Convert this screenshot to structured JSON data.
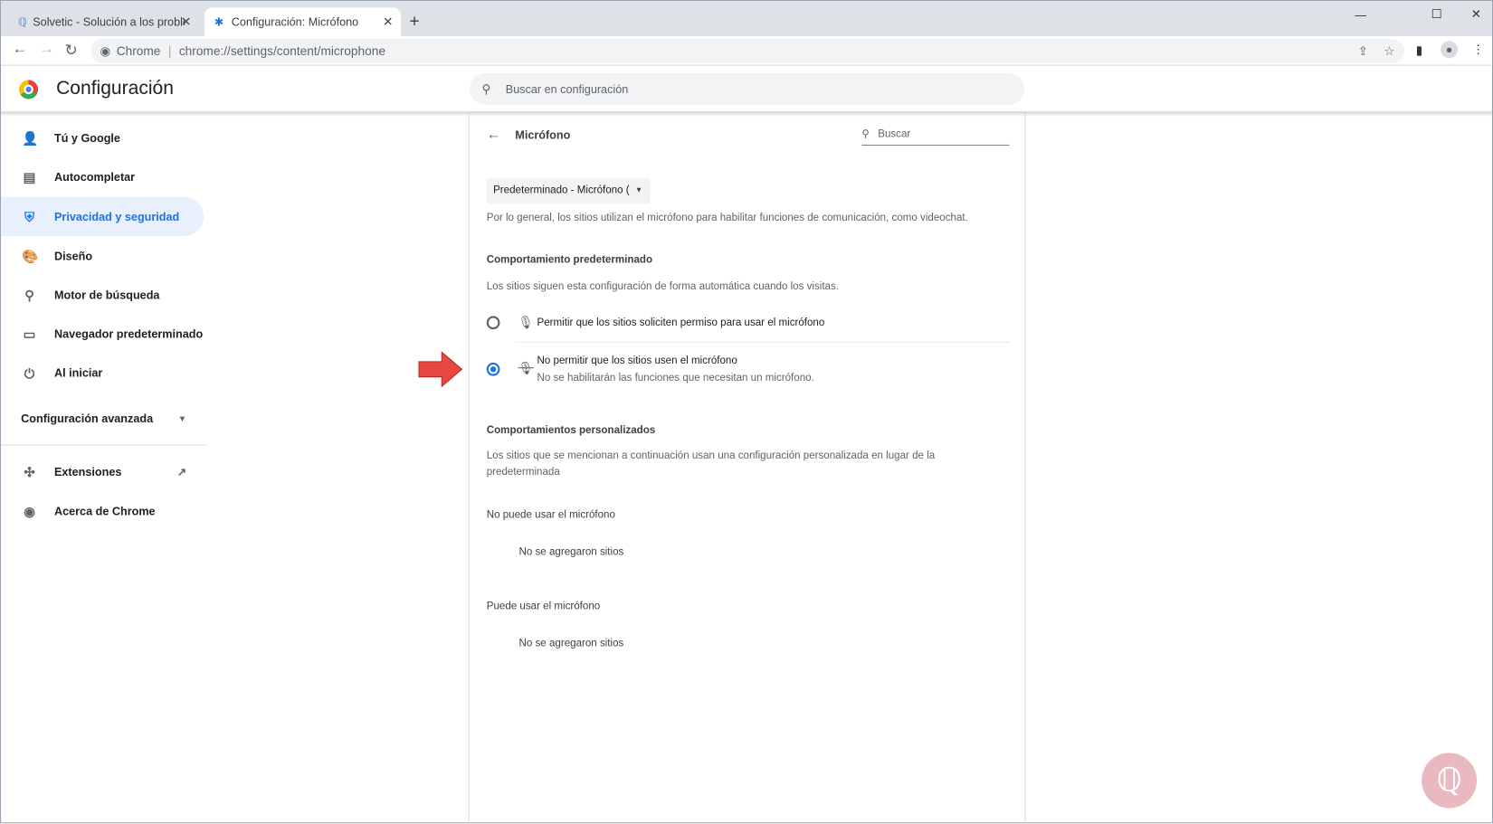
{
  "tabs": [
    {
      "title": "Solvetic - Solución a los problem",
      "icon": "solvetic-icon"
    },
    {
      "title": "Configuración: Micrófono",
      "icon": "gear-icon"
    }
  ],
  "new_tab": "+",
  "window_controls": {
    "minimize": "—",
    "maximize": "☐",
    "close": "✕"
  },
  "address": {
    "site_label": "Chrome",
    "url": "chrome://settings/content/microphone"
  },
  "header": {
    "title": "Configuración",
    "search_placeholder": "Buscar en configuración"
  },
  "sidebar": {
    "items": [
      {
        "label": "Tú y Google",
        "icon": "person-icon"
      },
      {
        "label": "Autocompletar",
        "icon": "clipboard-icon"
      },
      {
        "label": "Privacidad y seguridad",
        "icon": "shield-icon",
        "active": true
      },
      {
        "label": "Diseño",
        "icon": "palette-icon"
      },
      {
        "label": "Motor de búsqueda",
        "icon": "search-icon"
      },
      {
        "label": "Navegador predeterminado",
        "icon": "browser-icon"
      },
      {
        "label": "Al iniciar",
        "icon": "power-icon"
      }
    ],
    "advanced": "Configuración avanzada",
    "extensions": "Extensiones",
    "about": "Acerca de Chrome"
  },
  "panel": {
    "title": "Micrófono",
    "search_placeholder": "Buscar",
    "device_select": "Predeterminado - Micrófono (",
    "description": "Por lo general, los sitios utilizan el micrófono para habilitar funciones de comunicación, como videochat.",
    "default_heading": "Comportamiento predeterminado",
    "default_desc": "Los sitios siguen esta configuración de forma automática cuando los visitas.",
    "option_allow": "Permitir que los sitios soliciten permiso para usar el micrófono",
    "option_block": "No permitir que los sitios usen el micrófono",
    "option_block_sub": "No se habilitarán las funciones que necesitan un micrófono.",
    "selected": "block",
    "custom_heading": "Comportamientos personalizados",
    "custom_desc1": "Los sitios que se mencionan a continuación usan una configuración personalizada en lugar de la",
    "custom_desc2": "predeterminada",
    "blocked_heading": "No puede usar el micrófono",
    "blocked_empty": "No se agregaron sitios",
    "allowed_heading": "Puede usar el micrófono",
    "allowed_empty": "No se agregaron sitios"
  },
  "colors": {
    "accent": "#1a73e8",
    "arrow": "#e8483f"
  }
}
